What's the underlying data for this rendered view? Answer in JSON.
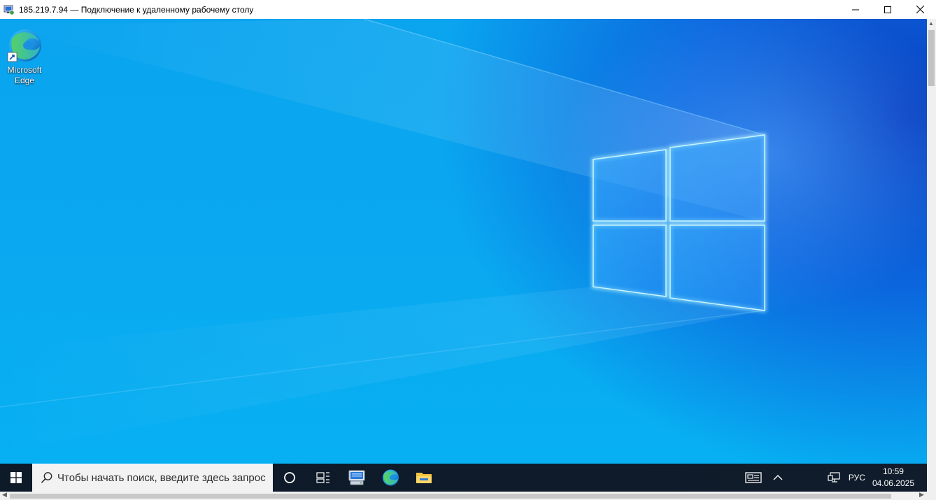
{
  "window": {
    "title": "185.219.7.94 — Подключение к удаленному рабочему столу",
    "icon": "remote-desktop-icon",
    "controls": [
      "minimize-icon",
      "maximize-icon",
      "close-icon"
    ]
  },
  "desktop": {
    "wallpaper": "windows-10-hero",
    "icons": [
      {
        "label": "Microsoft Edge",
        "icon": "edge-icon",
        "shortcut": true
      }
    ]
  },
  "taskbar": {
    "start_icon": "windows-logo-icon",
    "search_placeholder": "Чтобы начать поиск, введите здесь запрос",
    "buttons": [
      "cortana-icon",
      "task-view-icon",
      "server-manager-icon",
      "edge-icon",
      "file-explorer-icon"
    ],
    "tray": {
      "icons": [
        "news-icon",
        "chevron-up-icon",
        "network-icon"
      ],
      "language": "РУС",
      "time": "10:59",
      "date": "04.06.2025"
    }
  },
  "colors": {
    "taskbar": "#0f1b2a",
    "desktop_light": "#0aa8f0",
    "desktop_dark": "#0a3fc0"
  }
}
